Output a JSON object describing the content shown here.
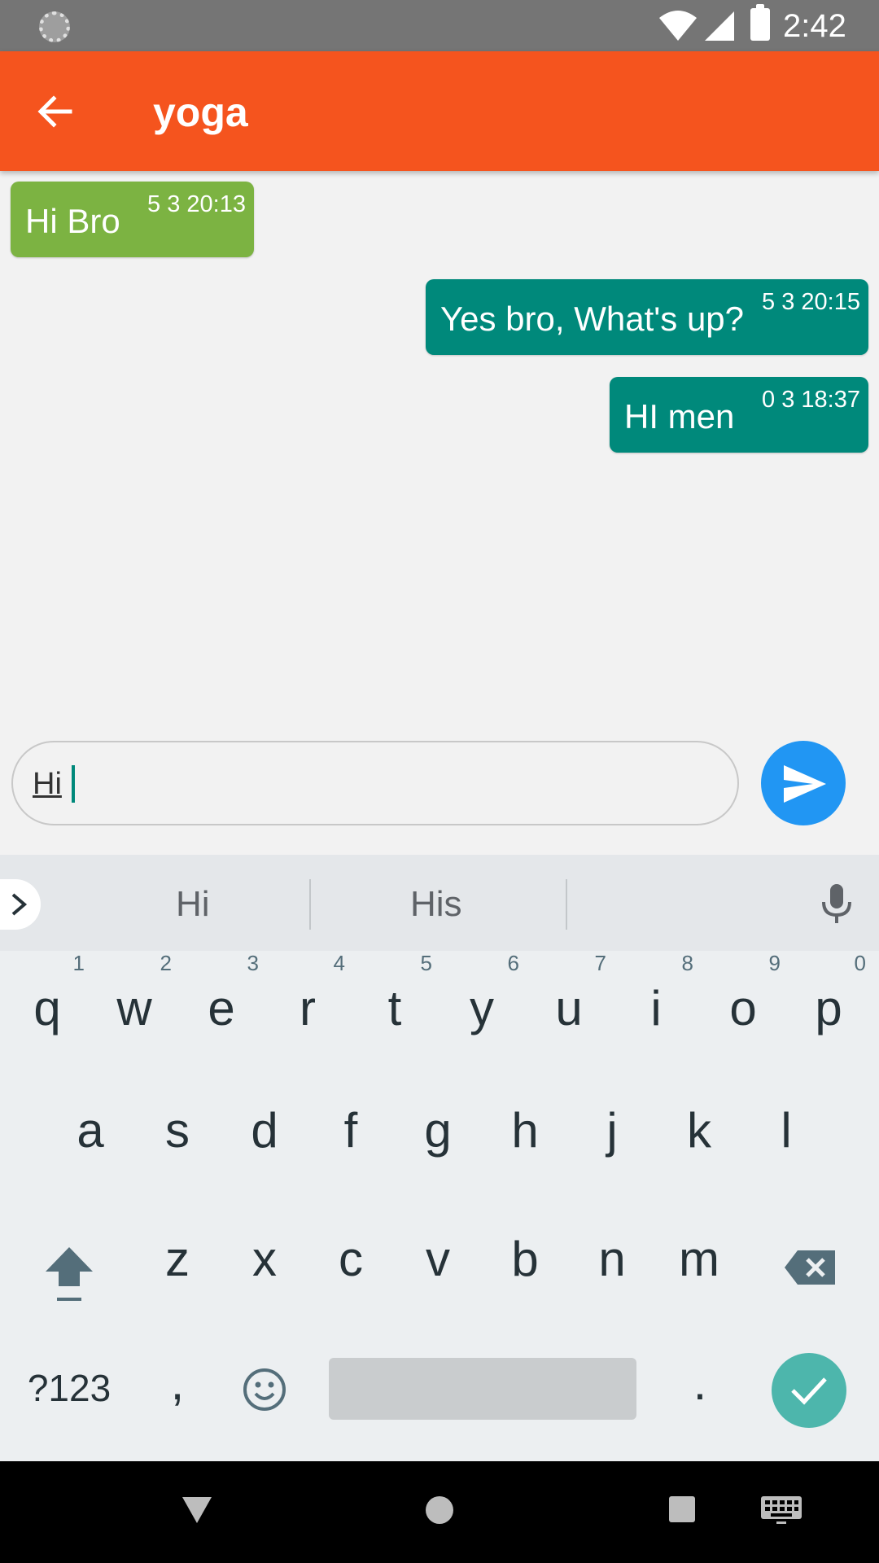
{
  "status_bar": {
    "time": "2:42"
  },
  "app_bar": {
    "title": "yoga"
  },
  "messages": [
    {
      "direction": "received",
      "text": "Hi Bro",
      "time": "5 3 20:13"
    },
    {
      "direction": "sent",
      "text": "Yes bro, What's up?",
      "time": "5 3 20:15"
    },
    {
      "direction": "sent",
      "text": "HI men",
      "time": "0 3 18:37"
    }
  ],
  "composer": {
    "value": "Hi"
  },
  "keyboard": {
    "suggestions": [
      "Hi",
      "His"
    ],
    "row1": [
      "q",
      "w",
      "e",
      "r",
      "t",
      "y",
      "u",
      "i",
      "o",
      "p"
    ],
    "row1_hints": [
      "1",
      "2",
      "3",
      "4",
      "5",
      "6",
      "7",
      "8",
      "9",
      "0"
    ],
    "row2": [
      "a",
      "s",
      "d",
      "f",
      "g",
      "h",
      "j",
      "k",
      "l"
    ],
    "row3": [
      "z",
      "x",
      "c",
      "v",
      "b",
      "n",
      "m"
    ],
    "symbols_label": "?123",
    "comma": ",",
    "period": "."
  },
  "colors": {
    "app_bar": "#f5541e",
    "received_bubble": "#7cb342",
    "sent_bubble": "#00897b",
    "send_button": "#2196f3",
    "enter_key": "#4db6ac"
  }
}
